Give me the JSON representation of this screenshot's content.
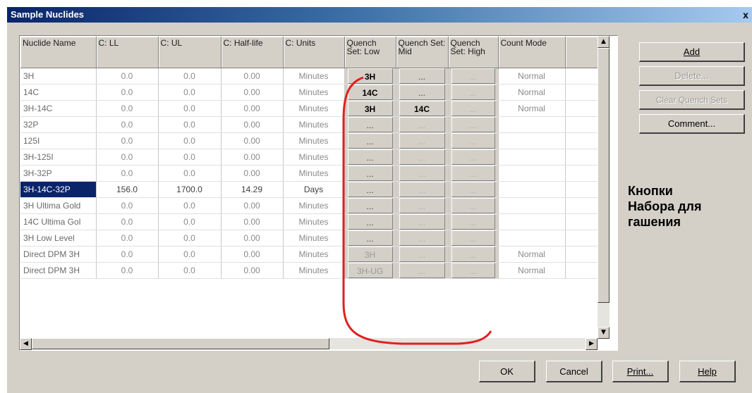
{
  "window": {
    "title": "Sample Nuclides",
    "close_glyph": "x"
  },
  "table": {
    "columns": [
      "Nuclide Name",
      "C: LL",
      "C: UL",
      "C: Half-life",
      "C: Units",
      "Quench Set: Low",
      "Quench Set: Mid",
      "Quench Set: High",
      "Count Mode"
    ],
    "rows": [
      {
        "name": "3H",
        "ll": "0.0",
        "ul": "0.0",
        "half": "0.00",
        "units": "Minutes",
        "low": "3H",
        "mid": "...",
        "high": "...",
        "mode": "Normal"
      },
      {
        "name": "14C",
        "ll": "0.0",
        "ul": "0.0",
        "half": "0.00",
        "units": "Minutes",
        "low": "14C",
        "mid": "...",
        "high": "...",
        "mode": "Normal"
      },
      {
        "name": "3H-14C",
        "ll": "0.0",
        "ul": "0.0",
        "half": "0.00",
        "units": "Minutes",
        "low": "3H",
        "mid": "14C",
        "high": "...",
        "mode": "Normal"
      },
      {
        "name": "32P",
        "ll": "0.0",
        "ul": "0.0",
        "half": "0.00",
        "units": "Minutes",
        "low": "...",
        "mid": "...",
        "high": "...",
        "mode": ""
      },
      {
        "name": "125I",
        "ll": "0.0",
        "ul": "0.0",
        "half": "0.00",
        "units": "Minutes",
        "low": "...",
        "mid": "...",
        "high": "...",
        "mode": ""
      },
      {
        "name": "3H-125I",
        "ll": "0.0",
        "ul": "0.0",
        "half": "0.00",
        "units": "Minutes",
        "low": "...",
        "mid": "...",
        "high": "...",
        "mode": ""
      },
      {
        "name": "3H-32P",
        "ll": "0.0",
        "ul": "0.0",
        "half": "0.00",
        "units": "Minutes",
        "low": "...",
        "mid": "...",
        "high": "...",
        "mode": ""
      },
      {
        "name": "3H-14C-32P",
        "ll": "156.0",
        "ul": "1700.0",
        "half": "14.29",
        "units": "Days",
        "low": "...",
        "mid": "...",
        "high": "...",
        "mode": ""
      },
      {
        "name": "3H Ultima Gold",
        "ll": "0.0",
        "ul": "0.0",
        "half": "0.00",
        "units": "Minutes",
        "low": "...",
        "mid": "...",
        "high": "...",
        "mode": ""
      },
      {
        "name": "14C Ultima Gol",
        "ll": "0.0",
        "ul": "0.0",
        "half": "0.00",
        "units": "Minutes",
        "low": "...",
        "mid": "...",
        "high": "...",
        "mode": ""
      },
      {
        "name": "3H Low Level",
        "ll": "0.0",
        "ul": "0.0",
        "half": "0.00",
        "units": "Minutes",
        "low": "...",
        "mid": "...",
        "high": "...",
        "mode": ""
      },
      {
        "name": "Direct DPM 3H",
        "ll": "0.0",
        "ul": "0.0",
        "half": "0.00",
        "units": "Minutes",
        "low": "3H",
        "mid": "...",
        "high": "...",
        "mode": "Normal"
      },
      {
        "name": "Direct DPM 3H",
        "ll": "0.0",
        "ul": "0.0",
        "half": "0.00",
        "units": "Minutes",
        "low": "3H-UG",
        "mid": "...",
        "high": "...",
        "mode": "Normal"
      }
    ],
    "selected_row": 7
  },
  "side_buttons": {
    "add": "Add",
    "delete": "Delete...",
    "clear_quench": "Clear Quench Sets",
    "comment": "Comment..."
  },
  "bottom_buttons": {
    "ok": "OK",
    "cancel": "Cancel",
    "print": "Print...",
    "help": "Help"
  },
  "annotation": {
    "text": "Кнопки\nНабора для\nгашения",
    "color": "#e02020"
  },
  "icons": {
    "close": "close-icon",
    "up": "scroll-up-arrow-icon",
    "down": "scroll-down-arrow-icon",
    "left": "scroll-left-arrow-icon",
    "right": "scroll-right-arrow-icon"
  }
}
